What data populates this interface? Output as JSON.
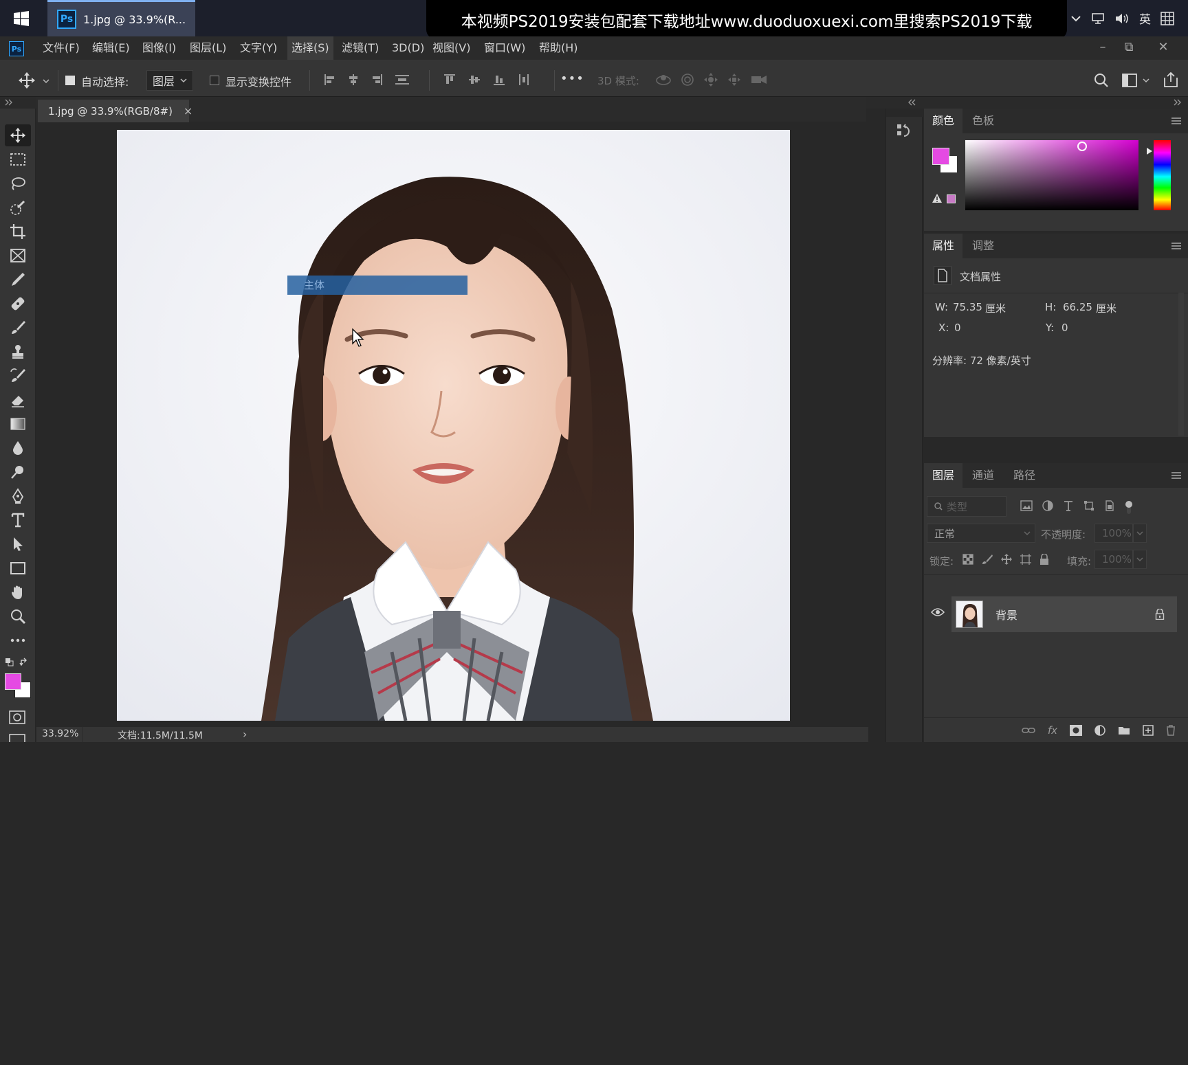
{
  "taskbar": {
    "app_tab_label": "1.jpg @ 33.9%(R...",
    "ps_icon_text": "Ps",
    "banner_text": "本视频PS2019安装包配套下载地址www.duoduoxuexi.com里搜索PS2019下载",
    "ime_label": "英"
  },
  "menubar": {
    "logo_text": "Ps",
    "items": [
      {
        "label": "文件(F)"
      },
      {
        "label": "编辑(E)"
      },
      {
        "label": "图像(I)"
      },
      {
        "label": "图层(L)"
      },
      {
        "label": "文字(Y)"
      },
      {
        "label": "选择(S)",
        "active": true
      },
      {
        "label": "滤镜(T)"
      },
      {
        "label": "3D(D)"
      },
      {
        "label": "视图(V)"
      },
      {
        "label": "窗口(W)"
      },
      {
        "label": "帮助(H)"
      }
    ],
    "window_controls": {
      "minimize": "–",
      "restore": "⧉",
      "close": "✕"
    }
  },
  "options_bar": {
    "auto_select_label": "自动选择:",
    "auto_select_checked": true,
    "auto_select_target": "图层",
    "show_transform_label": "显示变换控件",
    "show_transform_checked": false,
    "more_label": "•••",
    "mode_3d_label": "3D 模式:"
  },
  "document": {
    "tab_label": "1.jpg @ 33.9%(RGB/8#)",
    "tab_close": "×",
    "tooltip_text": "主体",
    "zoom": "33.92%",
    "doc_size": "文档:11.5M/11.5M",
    "status_arrow": "›"
  },
  "color_panel": {
    "tabs": [
      "颜色",
      "色板"
    ],
    "active_tab": 0,
    "foreground_color": "#e54ae3",
    "background_color": "#ffffff"
  },
  "properties_panel": {
    "tabs": [
      "属性",
      "调整"
    ],
    "active_tab": 0,
    "title": "文档属性",
    "w_label": "W:",
    "w_value": "75.35",
    "h_label": "H:",
    "h_value": "66.25",
    "unit": "厘米",
    "x_label": "X:",
    "x_value": "0",
    "y_label": "Y:",
    "y_value": "0",
    "resolution": "分辨率: 72 像素/英寸"
  },
  "layers_panel": {
    "tabs": [
      "图层",
      "通道",
      "路径"
    ],
    "active_tab": 0,
    "filter_placeholder": "类型",
    "blend_mode": "正常",
    "opacity_label": "不透明度:",
    "opacity_value": "100%",
    "lock_label": "锁定:",
    "fill_label": "填充:",
    "fill_value": "100%",
    "layers": [
      {
        "name": "背景",
        "visible": true,
        "locked": true
      }
    ]
  }
}
